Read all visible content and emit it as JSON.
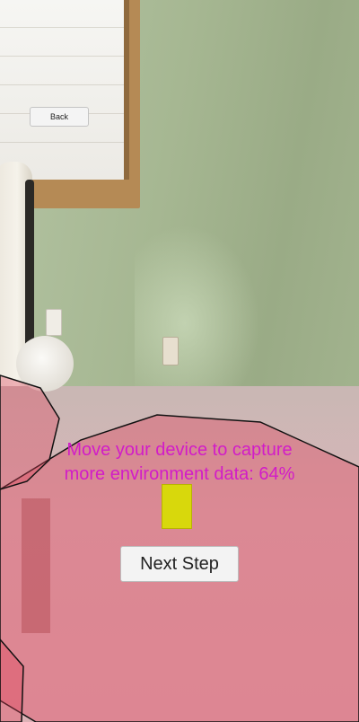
{
  "ui": {
    "back_label": "Back",
    "status_line_1": "Move your device to capture",
    "status_line_2": "more environment data: 64%",
    "next_label": "Next Step"
  },
  "scan_progress": 0.64,
  "colors": {
    "status_text": "#d21cc8",
    "plane_overlay": "#e0405a",
    "progress_marker": "#d8d80c"
  }
}
